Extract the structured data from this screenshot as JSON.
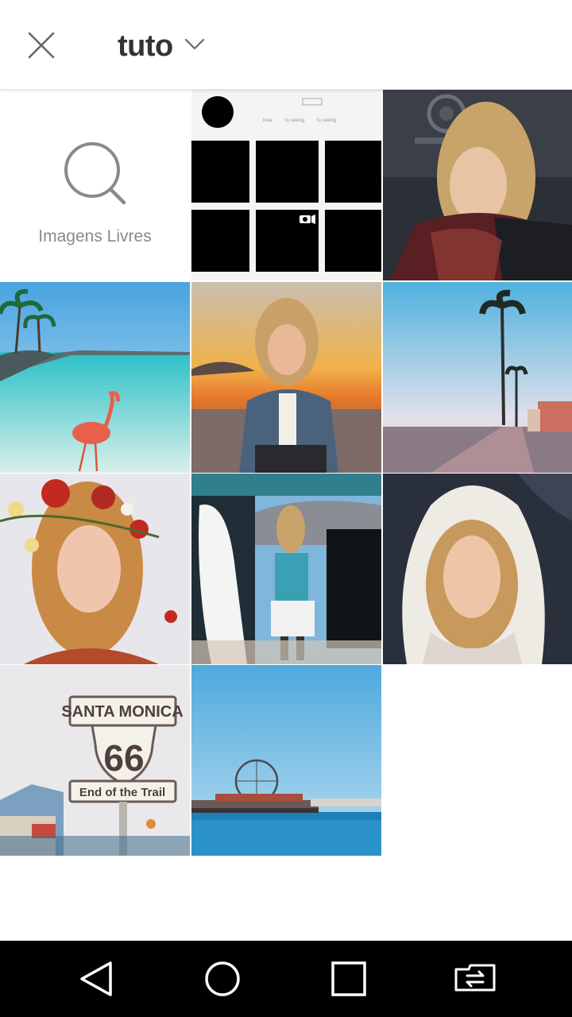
{
  "header": {
    "title": "tuto",
    "close_icon": "close-icon",
    "dropdown_icon": "chevron-down-icon"
  },
  "gallery": {
    "free_images_label": "Imagens Livres",
    "free_images_icon": "search-icon",
    "photos": [
      {
        "name": "photo-instagram-grid-screenshot"
      },
      {
        "name": "photo-man-dark-ornate-door"
      },
      {
        "name": "photo-flamingo-beach"
      },
      {
        "name": "photo-man-sunset-beach"
      },
      {
        "name": "photo-palm-trees-boardwalk"
      },
      {
        "name": "photo-man-flower-crown"
      },
      {
        "name": "photo-man-surfboard-van"
      },
      {
        "name": "photo-man-white-hoodie"
      },
      {
        "name": "photo-santa-monica-sign"
      },
      {
        "name": "photo-santa-monica-pier"
      }
    ],
    "screenshot_texts": [
      "bola",
      "to seeing",
      "fo seeing"
    ],
    "sign": {
      "top": "SANTA MONICA",
      "number": "66",
      "bottom": "End of the Trail"
    }
  },
  "navigation": {
    "back_icon": "back-triangle-icon",
    "home_icon": "home-circle-icon",
    "recents_icon": "recents-square-icon",
    "switch_icon": "app-switch-icon"
  },
  "colors": {
    "accent_text": "#333333",
    "label_gray": "#8a8a8a",
    "nav_background": "#000000"
  }
}
